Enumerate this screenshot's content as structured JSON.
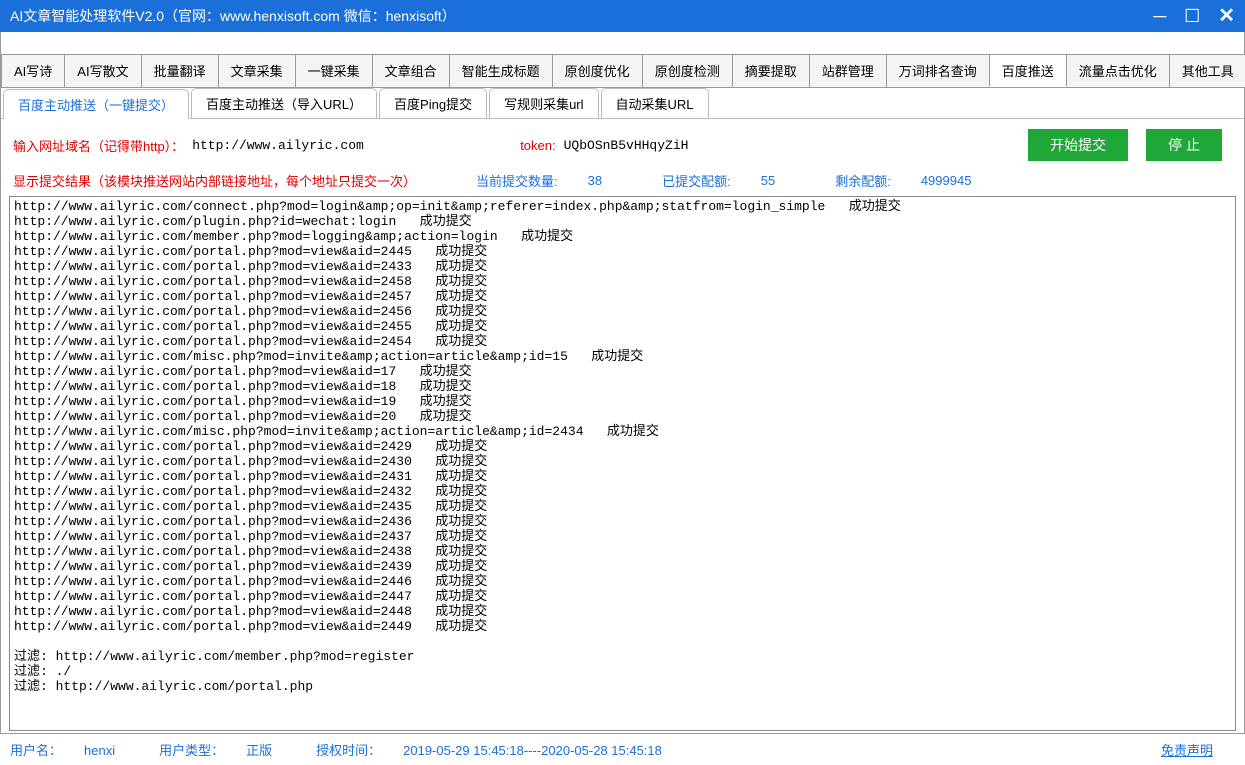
{
  "window": {
    "title": "AI文章智能处理软件V2.0（官网：www.henxisoft.com  微信：henxisoft）"
  },
  "main_tabs": [
    "AI写诗",
    "AI写散文",
    "批量翻译",
    "文章采集",
    "一键采集",
    "文章组合",
    "智能生成标题",
    "原创度优化",
    "原创度检测",
    "摘要提取",
    "站群管理",
    "万词排名查询",
    "百度推送",
    "流量点击优化",
    "其他工具"
  ],
  "main_tab_active_index": 12,
  "sub_tabs": [
    "百度主动推送（一键提交）",
    "百度主动推送（导入URL）",
    "百度Ping提交",
    "写规则采集url",
    "自动采集URL"
  ],
  "sub_tab_active_index": 0,
  "input_row": {
    "url_label": "输入网址域名（记得带http）：",
    "url_value": "http://www.ailyric.com",
    "token_label": "token:",
    "token_value": "UQbOSnB5vHHqyZiH",
    "start_btn": "开始提交",
    "stop_btn": "停 止"
  },
  "status_row": {
    "result_label": "显示提交结果（该模块推送网站内部链接地址，每个地址只提交一次）",
    "current_label": "当前提交数量:",
    "current_value": "38",
    "submitted_label": "已提交配额:",
    "submitted_value": "55",
    "remain_label": "剩余配额:",
    "remain_value": "4999945"
  },
  "log_lines": [
    "http://www.ailyric.com/connect.php?mod=login&amp;op=init&amp;referer=index.php&amp;statfrom=login_simple   成功提交",
    "http://www.ailyric.com/plugin.php?id=wechat:login   成功提交",
    "http://www.ailyric.com/member.php?mod=logging&amp;action=login   成功提交",
    "http://www.ailyric.com/portal.php?mod=view&aid=2445   成功提交",
    "http://www.ailyric.com/portal.php?mod=view&aid=2433   成功提交",
    "http://www.ailyric.com/portal.php?mod=view&aid=2458   成功提交",
    "http://www.ailyric.com/portal.php?mod=view&aid=2457   成功提交",
    "http://www.ailyric.com/portal.php?mod=view&aid=2456   成功提交",
    "http://www.ailyric.com/portal.php?mod=view&aid=2455   成功提交",
    "http://www.ailyric.com/portal.php?mod=view&aid=2454   成功提交",
    "http://www.ailyric.com/misc.php?mod=invite&amp;action=article&amp;id=15   成功提交",
    "http://www.ailyric.com/portal.php?mod=view&aid=17   成功提交",
    "http://www.ailyric.com/portal.php?mod=view&aid=18   成功提交",
    "http://www.ailyric.com/portal.php?mod=view&aid=19   成功提交",
    "http://www.ailyric.com/portal.php?mod=view&aid=20   成功提交",
    "http://www.ailyric.com/misc.php?mod=invite&amp;action=article&amp;id=2434   成功提交",
    "http://www.ailyric.com/portal.php?mod=view&aid=2429   成功提交",
    "http://www.ailyric.com/portal.php?mod=view&aid=2430   成功提交",
    "http://www.ailyric.com/portal.php?mod=view&aid=2431   成功提交",
    "http://www.ailyric.com/portal.php?mod=view&aid=2432   成功提交",
    "http://www.ailyric.com/portal.php?mod=view&aid=2435   成功提交",
    "http://www.ailyric.com/portal.php?mod=view&aid=2436   成功提交",
    "http://www.ailyric.com/portal.php?mod=view&aid=2437   成功提交",
    "http://www.ailyric.com/portal.php?mod=view&aid=2438   成功提交",
    "http://www.ailyric.com/portal.php?mod=view&aid=2439   成功提交",
    "http://www.ailyric.com/portal.php?mod=view&aid=2446   成功提交",
    "http://www.ailyric.com/portal.php?mod=view&aid=2447   成功提交",
    "http://www.ailyric.com/portal.php?mod=view&aid=2448   成功提交",
    "http://www.ailyric.com/portal.php?mod=view&aid=2449   成功提交",
    "",
    "过滤: http://www.ailyric.com/member.php?mod=register",
    "过滤: ./",
    "过滤: http://www.ailyric.com/portal.php"
  ],
  "footer": {
    "username_label": "用户名：",
    "username_value": "henxi",
    "usertype_label": "用户类型：",
    "usertype_value": "正版",
    "authtime_label": "授权时间：",
    "authtime_value": "2019-05-29 15:45:18----2020-05-28 15:45:18",
    "disclaimer": "免责声明"
  }
}
